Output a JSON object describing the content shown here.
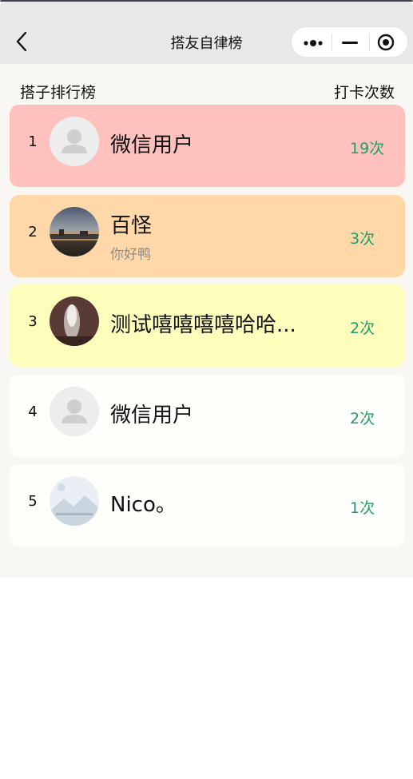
{
  "nav": {
    "title": "搭友自律榜"
  },
  "header": {
    "left": "搭子排行榜",
    "right": "打卡次数"
  },
  "colors": {
    "rank1": "#fec1bd",
    "rank2": "#fed8a8",
    "rank3": "#fefebc",
    "default": "#fefefa",
    "count": "#1f9e69"
  },
  "ranking": [
    {
      "rank": "1",
      "name": "微信用户",
      "subtitle": "",
      "count": "19次",
      "avatar": "default-avatar-icon"
    },
    {
      "rank": "2",
      "name": "百怪",
      "subtitle": "你好鸭",
      "count": "3次",
      "avatar": "sunset-photo"
    },
    {
      "rank": "3",
      "name": "测试嘻嘻嘻嘻哈哈...",
      "subtitle": "",
      "count": "2次",
      "avatar": "fireworks-photo"
    },
    {
      "rank": "4",
      "name": "微信用户",
      "subtitle": "",
      "count": "2次",
      "avatar": "default-avatar-icon"
    },
    {
      "rank": "5",
      "name": "Nico。",
      "subtitle": "",
      "count": "1次",
      "avatar": "mountain-photo"
    }
  ]
}
